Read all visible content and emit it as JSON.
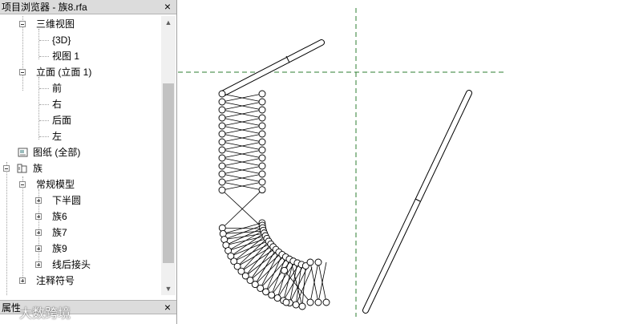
{
  "project_browser": {
    "title": "项目浏览器 - 族8.rfa",
    "close_label": "×",
    "items": [
      {
        "label": "三维视图",
        "expander": "minus",
        "icon": ""
      },
      {
        "label": "{3D}",
        "expander": "",
        "icon": ""
      },
      {
        "label": "视图 1",
        "expander": "",
        "icon": ""
      },
      {
        "label": "立面 (立面 1)",
        "expander": "minus",
        "icon": ""
      },
      {
        "label": "前",
        "expander": "",
        "icon": ""
      },
      {
        "label": "右",
        "expander": "",
        "icon": ""
      },
      {
        "label": "后面",
        "expander": "",
        "icon": ""
      },
      {
        "label": "左",
        "expander": "",
        "icon": ""
      },
      {
        "label": "图纸 (全部)",
        "expander": "",
        "icon": "sheets-icon"
      },
      {
        "label": "族",
        "expander": "minus",
        "icon": "families-icon"
      },
      {
        "label": "常规模型",
        "expander": "minus",
        "icon": ""
      },
      {
        "label": "下半圆",
        "expander": "plus",
        "icon": ""
      },
      {
        "label": "族6",
        "expander": "plus",
        "icon": ""
      },
      {
        "label": "族7",
        "expander": "plus",
        "icon": ""
      },
      {
        "label": "族9",
        "expander": "plus",
        "icon": ""
      },
      {
        "label": "线后接头",
        "expander": "plus",
        "icon": ""
      },
      {
        "label": "注释符号",
        "expander": "plus",
        "icon": ""
      }
    ]
  },
  "properties_panel": {
    "title": "属性",
    "close_label": "×"
  },
  "watermark": {
    "text": "大数跨境"
  },
  "colors": {
    "panel_header": "#dcdcdc",
    "reference_line": "#2e7d32",
    "model_line": "#000000"
  }
}
